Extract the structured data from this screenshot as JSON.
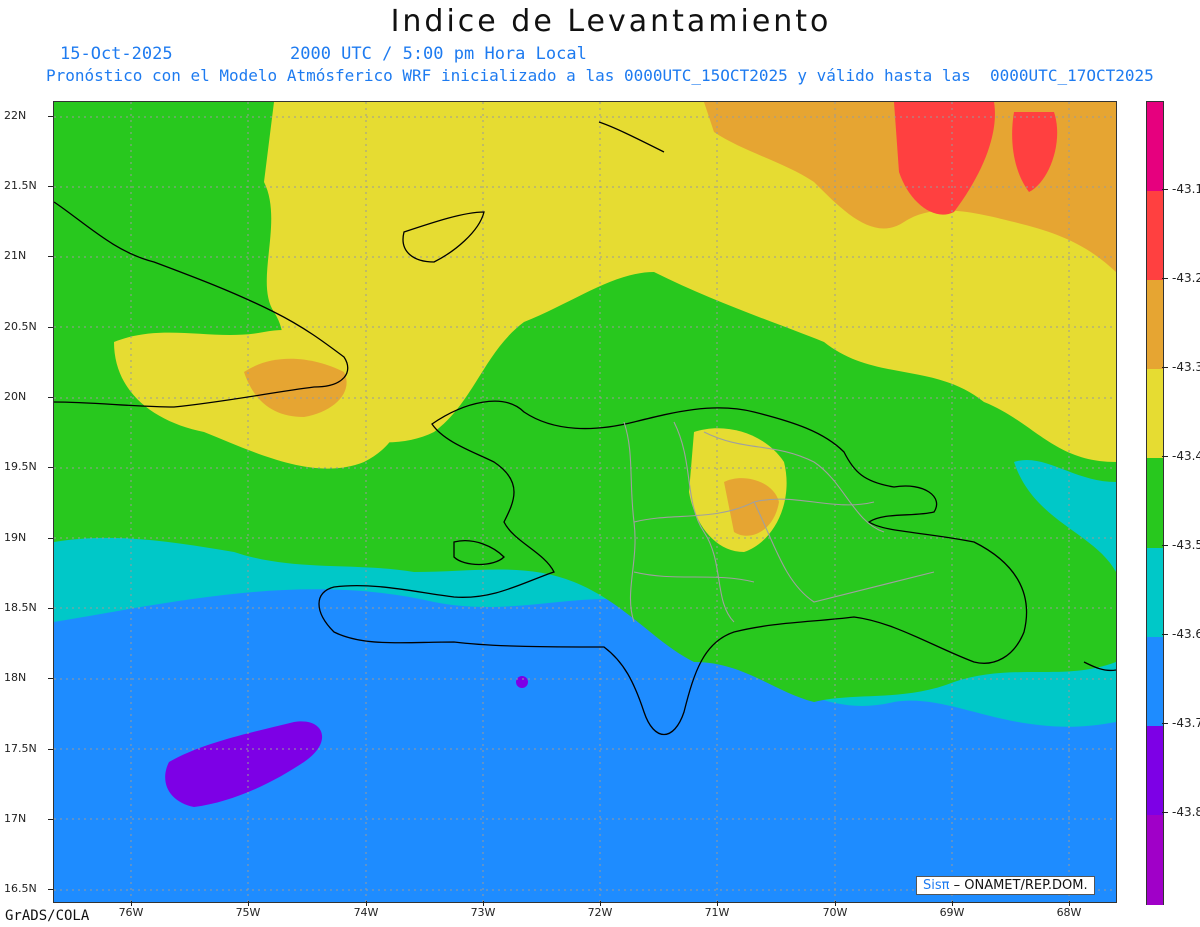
{
  "title": "Indice de Levantamiento",
  "header": {
    "date": "15-Oct-2025",
    "time": "2000 UTC / 5:00 pm Hora Local",
    "model_line": "Pronóstico con el Modelo Atmósferico WRF inicializado a las 0000UTC_15OCT2025 y válido hasta las  0000UTC_17OCT2025"
  },
  "axes": {
    "lat_labels": [
      "22N",
      "21.5N",
      "21N",
      "20.5N",
      "20N",
      "19.5N",
      "19N",
      "18.5N",
      "18N",
      "17.5N",
      "17N",
      "16.5N"
    ],
    "lon_labels": [
      "76W",
      "75W",
      "74W",
      "73W",
      "72W",
      "71W",
      "70W",
      "69W",
      "68W"
    ]
  },
  "colorbar": {
    "labels": [
      "-43.1",
      "-43.2",
      "-43.3",
      "-43.4",
      "-43.5",
      "-43.6",
      "-43.7",
      "-43.8"
    ],
    "colors": [
      "#e6007e",
      "#ff4040",
      "#e6a532",
      "#e6dc32",
      "#28c81e",
      "#00c8c8",
      "#1e8cff",
      "#7d00e6",
      "#a000c8"
    ]
  },
  "footer": {
    "software": "GrADS/COLA",
    "credit_brand": "Sisπ",
    "credit_text": " – ONAMET/REP.DOM."
  }
}
